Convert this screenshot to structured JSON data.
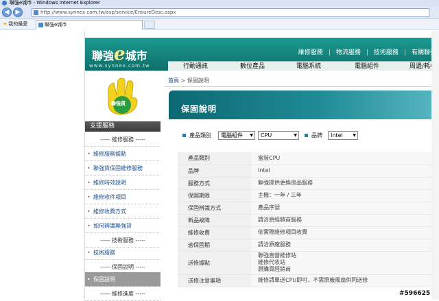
{
  "browser": {
    "title": "聯強e城市 - Windows Internet Explorer",
    "url": "http://www.synnex.com.tw/asp/service/EnsureDesc.aspx",
    "favorites_label": "我的最愛",
    "tab_label": "聯強e城市"
  },
  "site": {
    "logo_a": "聯強",
    "logo_e": "e",
    "logo_b": "城市",
    "logo_url": "www.synnex.com.tw",
    "top_links": [
      "維修服務",
      "物流服務",
      "技術服務",
      "有關聯強"
    ],
    "menu": [
      "行動通訊",
      "數位產品",
      "電腦系統",
      "電腦組件",
      "周邊/耗材"
    ]
  },
  "sidebar": {
    "badge_text": "聯強貨",
    "section_title": "支援服務",
    "items": [
      {
        "label": "維修服務",
        "type": "header"
      },
      {
        "label": "維修服務據點",
        "type": "link"
      },
      {
        "label": "聯強貨保固維修服務",
        "type": "link"
      },
      {
        "label": "維修時效說明",
        "type": "link"
      },
      {
        "label": "維修收件項目",
        "type": "link"
      },
      {
        "label": "維修收費方式",
        "type": "link"
      },
      {
        "label": "如何辨識聯強貨",
        "type": "link"
      },
      {
        "label": "技術服務",
        "type": "header"
      },
      {
        "label": "技術服務",
        "type": "link"
      },
      {
        "label": "保固說明",
        "type": "header"
      },
      {
        "label": "保固說明",
        "type": "active"
      },
      {
        "label": "維修進度",
        "type": "header"
      }
    ]
  },
  "breadcrumb": {
    "home": "首頁",
    "sep": ">",
    "current": "保固說明"
  },
  "banner_title": "保固說明",
  "filter": {
    "category_label": "產品類別",
    "category_value": "電腦組件",
    "subcategory_value": "CPU",
    "brand_label": "品牌",
    "brand_value": "Intel"
  },
  "spec": [
    {
      "k": "產品類別",
      "v": [
        "盒裝CPU"
      ]
    },
    {
      "k": "品牌",
      "v": [
        "Intel"
      ]
    },
    {
      "k": "服務方式",
      "v": [
        "聯強提供更換良品服務"
      ]
    },
    {
      "k": "保固期限",
      "v": [
        "主機：一年 / 三年"
      ]
    },
    {
      "k": "保固辨識方式",
      "v": [
        "產品序號"
      ]
    },
    {
      "k": "新品故障",
      "v": [
        "請洽原經銷商服務"
      ]
    },
    {
      "k": "維修收費",
      "v": [
        "依實際維修項目收費"
      ]
    },
    {
      "k": "逾保固期",
      "v": [
        "請洽原廠服務"
      ]
    },
    {
      "k": "送修據點",
      "v": [
        "聯強直營維修站",
        "維修代收站",
        "原購買經銷商"
      ]
    },
    {
      "k": "送修注意事項",
      "v": [
        "維修請單送CPU即可，不需原廠風扇併同送修"
      ]
    }
  ],
  "watermark": "#596625"
}
